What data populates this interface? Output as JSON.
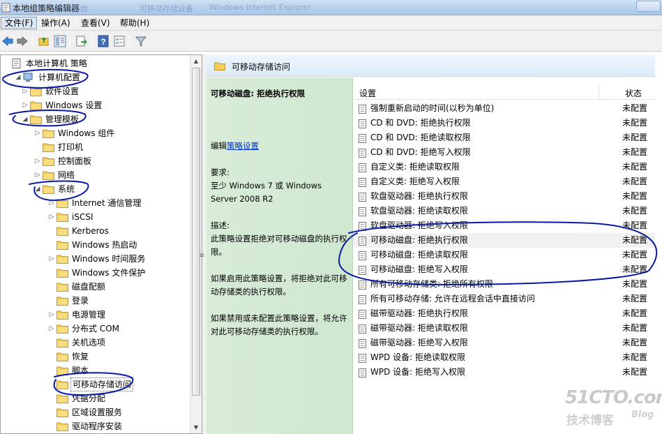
{
  "window": {
    "title": "本地组策略编辑器",
    "ghost_titles": [
      "开始",
      "可移动存储设备",
      "Windows Internet Explorer"
    ]
  },
  "menu": [
    "文件(F)",
    "操作(A)",
    "查看(V)",
    "帮助(H)"
  ],
  "toolbar": [
    "back-icon",
    "forward-icon",
    "up-folder-icon",
    "show-hide-tree-icon",
    "export-list-icon",
    "help-icon",
    "properties-icon",
    "filter-icon"
  ],
  "tree": {
    "items": [
      {
        "label": "本地计算机 策略",
        "depth": 0,
        "arrow": "",
        "icon": "policy"
      },
      {
        "label": "计算机配置",
        "depth": 1,
        "arrow": "open",
        "icon": "computer"
      },
      {
        "label": "软件设置",
        "depth": 2,
        "arrow": "closed",
        "icon": "folder"
      },
      {
        "label": "Windows 设置",
        "depth": 2,
        "arrow": "closed",
        "icon": "folder"
      },
      {
        "label": "管理模板",
        "depth": 2,
        "arrow": "open",
        "icon": "folder"
      },
      {
        "label": "Windows 组件",
        "depth": 3,
        "arrow": "closed",
        "icon": "folder"
      },
      {
        "label": "打印机",
        "depth": 3,
        "arrow": "",
        "icon": "folder"
      },
      {
        "label": "控制面板",
        "depth": 3,
        "arrow": "closed",
        "icon": "folder"
      },
      {
        "label": "网络",
        "depth": 3,
        "arrow": "closed",
        "icon": "folder"
      },
      {
        "label": "系统",
        "depth": 3,
        "arrow": "open",
        "icon": "folder"
      },
      {
        "label": "Internet 通信管理",
        "depth": 4,
        "arrow": "closed",
        "icon": "folder"
      },
      {
        "label": "iSCSI",
        "depth": 4,
        "arrow": "closed",
        "icon": "folder"
      },
      {
        "label": "Kerberos",
        "depth": 4,
        "arrow": "",
        "icon": "folder"
      },
      {
        "label": "Windows 热启动",
        "depth": 4,
        "arrow": "",
        "icon": "folder"
      },
      {
        "label": "Windows 时间服务",
        "depth": 4,
        "arrow": "closed",
        "icon": "folder"
      },
      {
        "label": "Windows 文件保护",
        "depth": 4,
        "arrow": "",
        "icon": "folder"
      },
      {
        "label": "磁盘配额",
        "depth": 4,
        "arrow": "",
        "icon": "folder"
      },
      {
        "label": "登录",
        "depth": 4,
        "arrow": "",
        "icon": "folder"
      },
      {
        "label": "电源管理",
        "depth": 4,
        "arrow": "closed",
        "icon": "folder"
      },
      {
        "label": "分布式 COM",
        "depth": 4,
        "arrow": "closed",
        "icon": "folder"
      },
      {
        "label": "关机选项",
        "depth": 4,
        "arrow": "",
        "icon": "folder"
      },
      {
        "label": "恢复",
        "depth": 4,
        "arrow": "",
        "icon": "folder"
      },
      {
        "label": "脚本",
        "depth": 4,
        "arrow": "",
        "icon": "folder"
      },
      {
        "label": "可移动存储访问",
        "depth": 4,
        "arrow": "",
        "icon": "folder",
        "selected": true
      },
      {
        "label": "凭据分配",
        "depth": 4,
        "arrow": "",
        "icon": "folder"
      },
      {
        "label": "区域设置服务",
        "depth": 4,
        "arrow": "",
        "icon": "folder"
      },
      {
        "label": "驱动程序安装",
        "depth": 4,
        "arrow": "",
        "icon": "folder"
      }
    ]
  },
  "right": {
    "header": "可移动存储访问",
    "description": {
      "title": "可移动磁盘: 拒绝执行权限",
      "edit_prefix": "编辑",
      "edit_link": "策略设置",
      "requirements_label": "要求:",
      "requirements": "至少 Windows 7 或 Windows Server 2008 R2",
      "desc_label": "描述:",
      "desc": "此策略设置拒绝对可移动磁盘的执行权限。",
      "enabled": "如果启用此策略设置，将拒绝对此可移动存储类的执行权限。",
      "disabled": "如果禁用或未配置此策略设置，将允许对此可移动存储类的执行权限。"
    },
    "columns": {
      "setting": "设置",
      "state": "状态"
    },
    "rows": [
      {
        "name": "强制重新启动的时间(以秒为单位)",
        "state": "未配置"
      },
      {
        "name": "CD 和 DVD: 拒绝执行权限",
        "state": "未配置"
      },
      {
        "name": "CD 和 DVD: 拒绝读取权限",
        "state": "未配置"
      },
      {
        "name": "CD 和 DVD: 拒绝写入权限",
        "state": "未配置"
      },
      {
        "name": "自定义类: 拒绝读取权限",
        "state": "未配置"
      },
      {
        "name": "自定义类: 拒绝写入权限",
        "state": "未配置"
      },
      {
        "name": "软盘驱动器: 拒绝执行权限",
        "state": "未配置"
      },
      {
        "name": "软盘驱动器: 拒绝读取权限",
        "state": "未配置"
      },
      {
        "name": "软盘驱动器: 拒绝写入权限",
        "state": "未配置"
      },
      {
        "name": "可移动磁盘: 拒绝执行权限",
        "state": "未配置",
        "highlight": true
      },
      {
        "name": "可移动磁盘: 拒绝读取权限",
        "state": "未配置"
      },
      {
        "name": "可移动磁盘: 拒绝写入权限",
        "state": "未配置"
      },
      {
        "name": "所有可移动存储类: 拒绝所有权限",
        "state": "未配置"
      },
      {
        "name": "所有可移动存储: 允许在远程会话中直接访问",
        "state": "未配置"
      },
      {
        "name": "磁带驱动器: 拒绝执行权限",
        "state": "未配置"
      },
      {
        "name": "磁带驱动器: 拒绝读取权限",
        "state": "未配置"
      },
      {
        "name": "磁带驱动器: 拒绝写入权限",
        "state": "未配置"
      },
      {
        "name": "WPD 设备: 拒绝读取权限",
        "state": "未配置"
      },
      {
        "name": "WPD 设备: 拒绝写入权限",
        "state": "未配置"
      }
    ]
  },
  "watermark": {
    "line1": "51CTO.com",
    "line2": "技术博客",
    "line3": "Blog"
  },
  "colors": {
    "ink": "#0a1aa8",
    "desc_bg": "#d4ead4",
    "header_bg": "#e4eff9",
    "link": "#0033cc"
  }
}
